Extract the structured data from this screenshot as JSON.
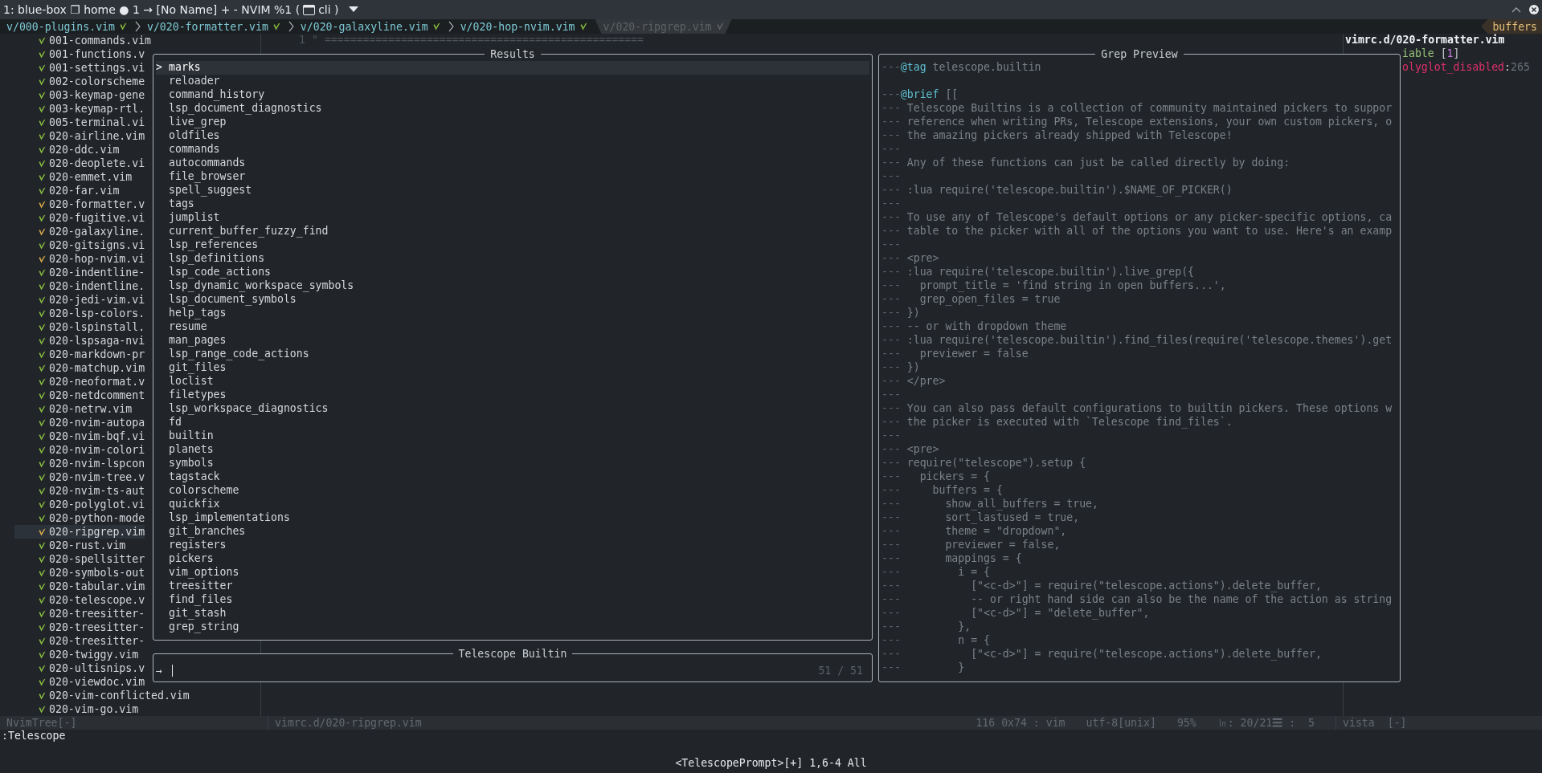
{
  "title_bar": {
    "text": "1: blue-box ❐ home ● 1 → [No Name] + - NVIM %1 (",
    "program": "cli )"
  },
  "tabline": {
    "crumbs": [
      {
        "label": "v/000-plugins.vim",
        "active": true
      },
      {
        "label": "v/020-formatter.vim",
        "active": true
      },
      {
        "label": "v/020-galaxyline.vim",
        "active": true
      },
      {
        "label": "v/020-hop-nvim.vim",
        "active": true
      },
      {
        "label": "v/020-ripgrep.vim",
        "active": false
      }
    ],
    "buffers_label": "buffers"
  },
  "nvim_tree": {
    "items": [
      {
        "name": "001-commands.vim",
        "modified": false,
        "selected": false
      },
      {
        "name": "001-functions.v",
        "modified": false,
        "selected": false
      },
      {
        "name": "001-settings.vi",
        "modified": false,
        "selected": false
      },
      {
        "name": "002-colorscheme",
        "modified": false,
        "selected": false
      },
      {
        "name": "003-keymap-gene",
        "modified": false,
        "selected": false
      },
      {
        "name": "003-keymap-rtl.",
        "modified": false,
        "selected": false
      },
      {
        "name": "005-terminal.vi",
        "modified": false,
        "selected": false
      },
      {
        "name": "020-airline.vim",
        "modified": false,
        "selected": false
      },
      {
        "name": "020-ddc.vim",
        "modified": false,
        "selected": false
      },
      {
        "name": "020-deoplete.vi",
        "modified": false,
        "selected": false
      },
      {
        "name": "020-emmet.vim",
        "modified": false,
        "selected": false
      },
      {
        "name": "020-far.vim",
        "modified": false,
        "selected": false
      },
      {
        "name": "020-formatter.v",
        "modified": true,
        "selected": false
      },
      {
        "name": "020-fugitive.vi",
        "modified": false,
        "selected": false
      },
      {
        "name": "020-galaxyline.",
        "modified": true,
        "selected": false
      },
      {
        "name": "020-gitsigns.vi",
        "modified": false,
        "selected": false
      },
      {
        "name": "020-hop-nvim.vi",
        "modified": true,
        "selected": false
      },
      {
        "name": "020-indentline-",
        "modified": false,
        "selected": false
      },
      {
        "name": "020-indentline.",
        "modified": false,
        "selected": false
      },
      {
        "name": "020-jedi-vim.vi",
        "modified": false,
        "selected": false
      },
      {
        "name": "020-lsp-colors.",
        "modified": false,
        "selected": false
      },
      {
        "name": "020-lspinstall.",
        "modified": false,
        "selected": false
      },
      {
        "name": "020-lspsaga-nvi",
        "modified": false,
        "selected": false
      },
      {
        "name": "020-markdown-pr",
        "modified": false,
        "selected": false
      },
      {
        "name": "020-matchup.vim",
        "modified": false,
        "selected": false
      },
      {
        "name": "020-neoformat.v",
        "modified": false,
        "selected": false
      },
      {
        "name": "020-netdcomment",
        "modified": false,
        "selected": false
      },
      {
        "name": "020-netrw.vim",
        "modified": false,
        "selected": false
      },
      {
        "name": "020-nvim-autopa",
        "modified": false,
        "selected": false
      },
      {
        "name": "020-nvim-bqf.vi",
        "modified": false,
        "selected": false
      },
      {
        "name": "020-nvim-colori",
        "modified": false,
        "selected": false
      },
      {
        "name": "020-nvim-lspcon",
        "modified": false,
        "selected": false
      },
      {
        "name": "020-nvim-tree.v",
        "modified": false,
        "selected": false
      },
      {
        "name": "020-nvim-ts-aut",
        "modified": false,
        "selected": false
      },
      {
        "name": "020-polyglot.vi",
        "modified": false,
        "selected": false
      },
      {
        "name": "020-python-mode",
        "modified": false,
        "selected": false
      },
      {
        "name": "020-ripgrep.vim",
        "modified": true,
        "selected": true
      },
      {
        "name": "020-rust.vim",
        "modified": false,
        "selected": false
      },
      {
        "name": "020-spellsitter",
        "modified": false,
        "selected": false
      },
      {
        "name": "020-symbols-out",
        "modified": false,
        "selected": false
      },
      {
        "name": "020-tabular.vim",
        "modified": false,
        "selected": false
      },
      {
        "name": "020-telescope.v",
        "modified": false,
        "selected": false
      },
      {
        "name": "020-treesitter-",
        "modified": false,
        "selected": false
      },
      {
        "name": "020-treesitter-",
        "modified": false,
        "selected": false
      },
      {
        "name": "020-treesitter-",
        "modified": false,
        "selected": false
      },
      {
        "name": "020-twiggy.vim",
        "modified": false,
        "selected": false
      },
      {
        "name": "020-ultisnips.v",
        "modified": false,
        "selected": false
      },
      {
        "name": "020-viewdoc.vim",
        "modified": false,
        "selected": false
      },
      {
        "name": "020-vim-conflicted.vim",
        "modified": false,
        "selected": false
      },
      {
        "name": "020-vim-go.vim",
        "modified": false,
        "selected": false
      }
    ],
    "status": "NvimTree[-]"
  },
  "editor": {
    "line_number": "1",
    "text": "\" ==================================================",
    "status_file": "vimrc.d/020-ripgrep.vim",
    "status_info": [
      "116 0x74 : vim",
      "utf-8[unix]",
      "95%",
      "㏑: 20/21☰ :  5"
    ]
  },
  "vista": {
    "title": "vimrc.d/020-formatter.vim",
    "lines": [
      {
        "parts": [
          {
            "text": "iable",
            "kind": "name"
          },
          {
            "text": " [",
            "kind": "punct"
          },
          {
            "text": "1",
            "kind": "number"
          },
          {
            "text": "]",
            "kind": "punct"
          }
        ]
      },
      {
        "parts": [
          {
            "text": "olyglot_disabled",
            "kind": "key"
          },
          {
            "text": ":",
            "kind": "punct"
          },
          {
            "text": "265",
            "kind": "line"
          }
        ]
      }
    ],
    "status": "vista",
    "status_flag": "[-]"
  },
  "telescope": {
    "results_title": "Results",
    "selection_caret": ">",
    "results": [
      {
        "label": "marks",
        "selected": true
      },
      {
        "label": "reloader",
        "selected": false
      },
      {
        "label": "command_history",
        "selected": false
      },
      {
        "label": "lsp_document_diagnostics",
        "selected": false
      },
      {
        "label": "live_grep",
        "selected": false
      },
      {
        "label": "oldfiles",
        "selected": false
      },
      {
        "label": "commands",
        "selected": false
      },
      {
        "label": "autocommands",
        "selected": false
      },
      {
        "label": "file_browser",
        "selected": false
      },
      {
        "label": "spell_suggest",
        "selected": false
      },
      {
        "label": "tags",
        "selected": false
      },
      {
        "label": "jumplist",
        "selected": false
      },
      {
        "label": "current_buffer_fuzzy_find",
        "selected": false
      },
      {
        "label": "lsp_references",
        "selected": false
      },
      {
        "label": "lsp_definitions",
        "selected": false
      },
      {
        "label": "lsp_code_actions",
        "selected": false
      },
      {
        "label": "lsp_dynamic_workspace_symbols",
        "selected": false
      },
      {
        "label": "lsp_document_symbols",
        "selected": false
      },
      {
        "label": "help_tags",
        "selected": false
      },
      {
        "label": "resume",
        "selected": false
      },
      {
        "label": "man_pages",
        "selected": false
      },
      {
        "label": "lsp_range_code_actions",
        "selected": false
      },
      {
        "label": "git_files",
        "selected": false
      },
      {
        "label": "loclist",
        "selected": false
      },
      {
        "label": "filetypes",
        "selected": false
      },
      {
        "label": "lsp_workspace_diagnostics",
        "selected": false
      },
      {
        "label": "fd",
        "selected": false
      },
      {
        "label": "builtin",
        "selected": false
      },
      {
        "label": "planets",
        "selected": false
      },
      {
        "label": "symbols",
        "selected": false
      },
      {
        "label": "tagstack",
        "selected": false
      },
      {
        "label": "colorscheme",
        "selected": false
      },
      {
        "label": "quickfix",
        "selected": false
      },
      {
        "label": "lsp_implementations",
        "selected": false
      },
      {
        "label": "git_branches",
        "selected": false
      },
      {
        "label": "registers",
        "selected": false
      },
      {
        "label": "pickers",
        "selected": false
      },
      {
        "label": "vim_options",
        "selected": false
      },
      {
        "label": "treesitter",
        "selected": false
      },
      {
        "label": "find_files",
        "selected": false
      },
      {
        "label": "git_stash",
        "selected": false
      },
      {
        "label": "grep_string",
        "selected": false
      }
    ],
    "prompt_title": "Telescope Builtin",
    "prompt_prefix": "→",
    "count": "51 / 51",
    "preview_title": "Grep Preview",
    "preview_lines": [
      {
        "kind": "tag",
        "dash": "---",
        "tag": "@tag",
        "text": "telescope.builtin"
      },
      {
        "kind": "blank"
      },
      {
        "kind": "tag",
        "dash": "---",
        "tag": "@brief",
        "text": "[["
      },
      {
        "kind": "comment",
        "dash": "---",
        "text": "Telescope Builtins is a collection of community maintained pickers to suppor"
      },
      {
        "kind": "comment",
        "dash": "---",
        "text": "reference when writing PRs, Telescope extensions, your own custom pickers, o"
      },
      {
        "kind": "comment",
        "dash": "---",
        "text": "the amazing pickers already shipped with Telescope!"
      },
      {
        "kind": "comment",
        "dash": "---"
      },
      {
        "kind": "comment",
        "dash": "---",
        "text": "Any of these functions can just be called directly by doing:"
      },
      {
        "kind": "comment",
        "dash": "---"
      },
      {
        "kind": "comment",
        "dash": "---",
        "text": ":lua require('telescope.builtin').$NAME_OF_PICKER()"
      },
      {
        "kind": "comment",
        "dash": "---"
      },
      {
        "kind": "comment",
        "dash": "---",
        "text": "To use any of Telescope's default options or any picker-specific options, ca"
      },
      {
        "kind": "comment",
        "dash": "---",
        "text": "table to the picker with all of the options you want to use. Here's an examp"
      },
      {
        "kind": "comment",
        "dash": "---"
      },
      {
        "kind": "comment",
        "dash": "---",
        "text": "<pre>"
      },
      {
        "kind": "comment",
        "dash": "---",
        "text": ":lua require('telescope.builtin').live_grep({"
      },
      {
        "kind": "comment",
        "dash": "---",
        "text": "  prompt_title = 'find string in open buffers...',"
      },
      {
        "kind": "comment",
        "dash": "---",
        "text": "  grep_open_files = true"
      },
      {
        "kind": "comment",
        "dash": "---",
        "text": "})"
      },
      {
        "kind": "comment",
        "dash": "---",
        "text": "-- or with dropdown theme"
      },
      {
        "kind": "comment",
        "dash": "---",
        "text": ":lua require('telescope.builtin').find_files(require('telescope.themes').get"
      },
      {
        "kind": "comment",
        "dash": "---",
        "text": "  previewer = false"
      },
      {
        "kind": "comment",
        "dash": "---",
        "text": "})"
      },
      {
        "kind": "comment",
        "dash": "---",
        "text": "</pre>"
      },
      {
        "kind": "comment",
        "dash": "---"
      },
      {
        "kind": "comment",
        "dash": "---",
        "text": "You can also pass default configurations to builtin pickers. These options w"
      },
      {
        "kind": "comment",
        "dash": "---",
        "text": "the picker is executed with `Telescope find_files`."
      },
      {
        "kind": "comment",
        "dash": "---"
      },
      {
        "kind": "comment",
        "dash": "---",
        "text": "<pre>"
      },
      {
        "kind": "comment",
        "dash": "---",
        "text": "require(\"telescope\").setup {"
      },
      {
        "kind": "comment",
        "dash": "---",
        "text": "  pickers = {"
      },
      {
        "kind": "comment",
        "dash": "---",
        "text": "    buffers = {"
      },
      {
        "kind": "comment",
        "dash": "---",
        "text": "      show_all_buffers = true,"
      },
      {
        "kind": "comment",
        "dash": "---",
        "text": "      sort_lastused = true,"
      },
      {
        "kind": "comment",
        "dash": "---",
        "text": "      theme = \"dropdown\","
      },
      {
        "kind": "comment",
        "dash": "---",
        "text": "      previewer = false,"
      },
      {
        "kind": "comment",
        "dash": "---",
        "text": "      mappings = {"
      },
      {
        "kind": "comment",
        "dash": "---",
        "text": "        i = {"
      },
      {
        "kind": "comment",
        "dash": "---",
        "text": "          [\"<c-d>\"] = require(\"telescope.actions\").delete_buffer,"
      },
      {
        "kind": "comment",
        "dash": "---",
        "text": "          -- or right hand side can also be the name of the action as string"
      },
      {
        "kind": "comment",
        "dash": "---",
        "text": "          [\"<c-d>\"] = \"delete_buffer\","
      },
      {
        "kind": "comment",
        "dash": "---",
        "text": "        },"
      },
      {
        "kind": "comment",
        "dash": "---",
        "text": "        n = {"
      },
      {
        "kind": "comment",
        "dash": "---",
        "text": "          [\"<c-d>\"] = require(\"telescope.actions\").delete_buffer,"
      },
      {
        "kind": "comment",
        "dash": "---",
        "text": "        }"
      }
    ]
  },
  "command_line": ":Telescope",
  "message": "<TelescopePrompt>[+] 1,6-4 All"
}
